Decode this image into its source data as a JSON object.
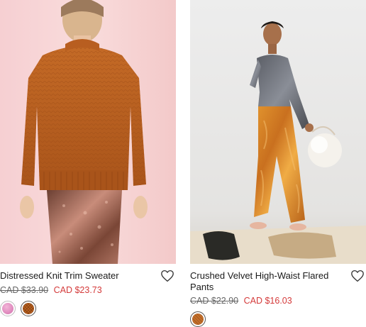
{
  "products": [
    {
      "name": "Distressed Knit Trim Sweater",
      "price_original": "CAD $33.90",
      "price_sale": "CAD $23.73",
      "swatches": [
        {
          "color": "#e08cbf",
          "label": "pink"
        },
        {
          "color": "#c6651f",
          "label": "rust"
        }
      ],
      "wishlist_icon": "heart-outline-icon"
    },
    {
      "name": "Crushed Velvet High-Waist Flared Pants",
      "price_original": "CAD $22.90",
      "price_sale": "CAD $16.03",
      "swatches": [
        {
          "color": "#c9712a",
          "label": "orange"
        }
      ],
      "wishlist_icon": "heart-outline-icon"
    }
  ],
  "colors": {
    "sale_price": "#d43a3a",
    "original_price": "#666666"
  }
}
